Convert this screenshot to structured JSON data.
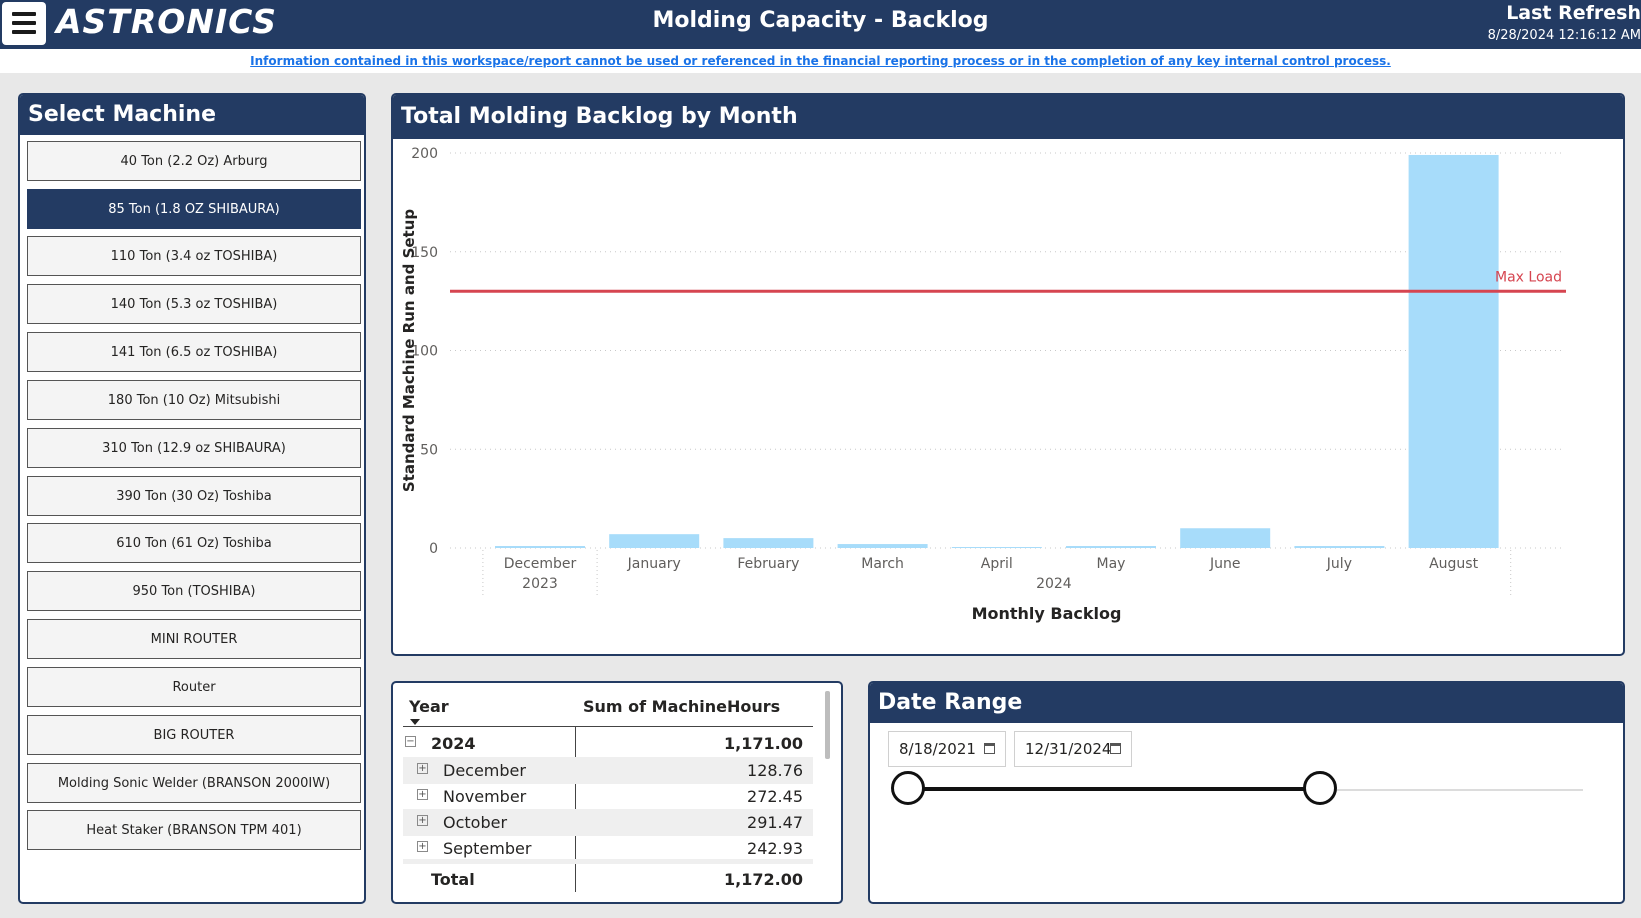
{
  "header": {
    "logo_text": "ASTRONICS",
    "title": "Molding Capacity - Backlog",
    "refresh_label": "Last Refresh",
    "refresh_date": "8/28/2024 12:16:12 AM"
  },
  "disclaimer": "Information contained in this workspace/report cannot be used or referenced in the financial reporting process or in the completion of any key internal control process.",
  "machine_panel": {
    "title": "Select Machine",
    "selected_index": 1,
    "machines": [
      "40 Ton (2.2 Oz) Arburg",
      "85 Ton (1.8 OZ SHIBAURA)",
      "110 Ton (3.4 oz TOSHIBA)",
      "140 Ton (5.3 oz TOSHIBA)",
      "141 Ton (6.5 oz TOSHIBA)",
      "180 Ton (10 Oz) Mitsubishi",
      "310 Ton (12.9 oz SHIBAURA)",
      "390 Ton (30 Oz) Toshiba",
      "610 Ton (61 Oz) Toshiba",
      "950 Ton (TOSHIBA)",
      "MINI ROUTER",
      "Router",
      "BIG ROUTER",
      "Molding Sonic Welder (BRANSON 2000IW)",
      "Heat Staker (BRANSON TPM 401)"
    ]
  },
  "chart_panel": {
    "title": "Total Molding Backlog by Month"
  },
  "chart_data": {
    "type": "bar",
    "categories": [
      "December",
      "January",
      "February",
      "March",
      "April",
      "May",
      "June",
      "July",
      "August"
    ],
    "year_groups": [
      {
        "label": "2023",
        "count": 1
      },
      {
        "label": "2024",
        "count": 8
      }
    ],
    "values": [
      1,
      7,
      5,
      2,
      0.5,
      1,
      10,
      1,
      199
    ],
    "xlabel": "Monthly Backlog",
    "ylabel": "Standard Machine Run and Setup",
    "ylim": [
      0,
      200
    ],
    "yticks": [
      0,
      50,
      100,
      150,
      200
    ],
    "reference_line": {
      "label": "Max Load",
      "value": 130
    },
    "bar_color": "#a7dcfa",
    "line_color": "#d64550",
    "grid": true
  },
  "table": {
    "headers": {
      "year": "Year",
      "sum": "Sum of MachineHours"
    },
    "group": {
      "label": "2024",
      "value": "1,171.00"
    },
    "rows": [
      {
        "label": "December",
        "value": "128.76"
      },
      {
        "label": "November",
        "value": "272.45"
      },
      {
        "label": "October",
        "value": "291.47"
      },
      {
        "label": "September",
        "value": "242.93"
      }
    ],
    "total": {
      "label": "Total",
      "value": "1,172.00"
    }
  },
  "date_range": {
    "title": "Date Range",
    "start": "8/18/2021",
    "end": "12/31/2024",
    "slider_start_fraction": 0,
    "slider_end_fraction": 0.63
  }
}
